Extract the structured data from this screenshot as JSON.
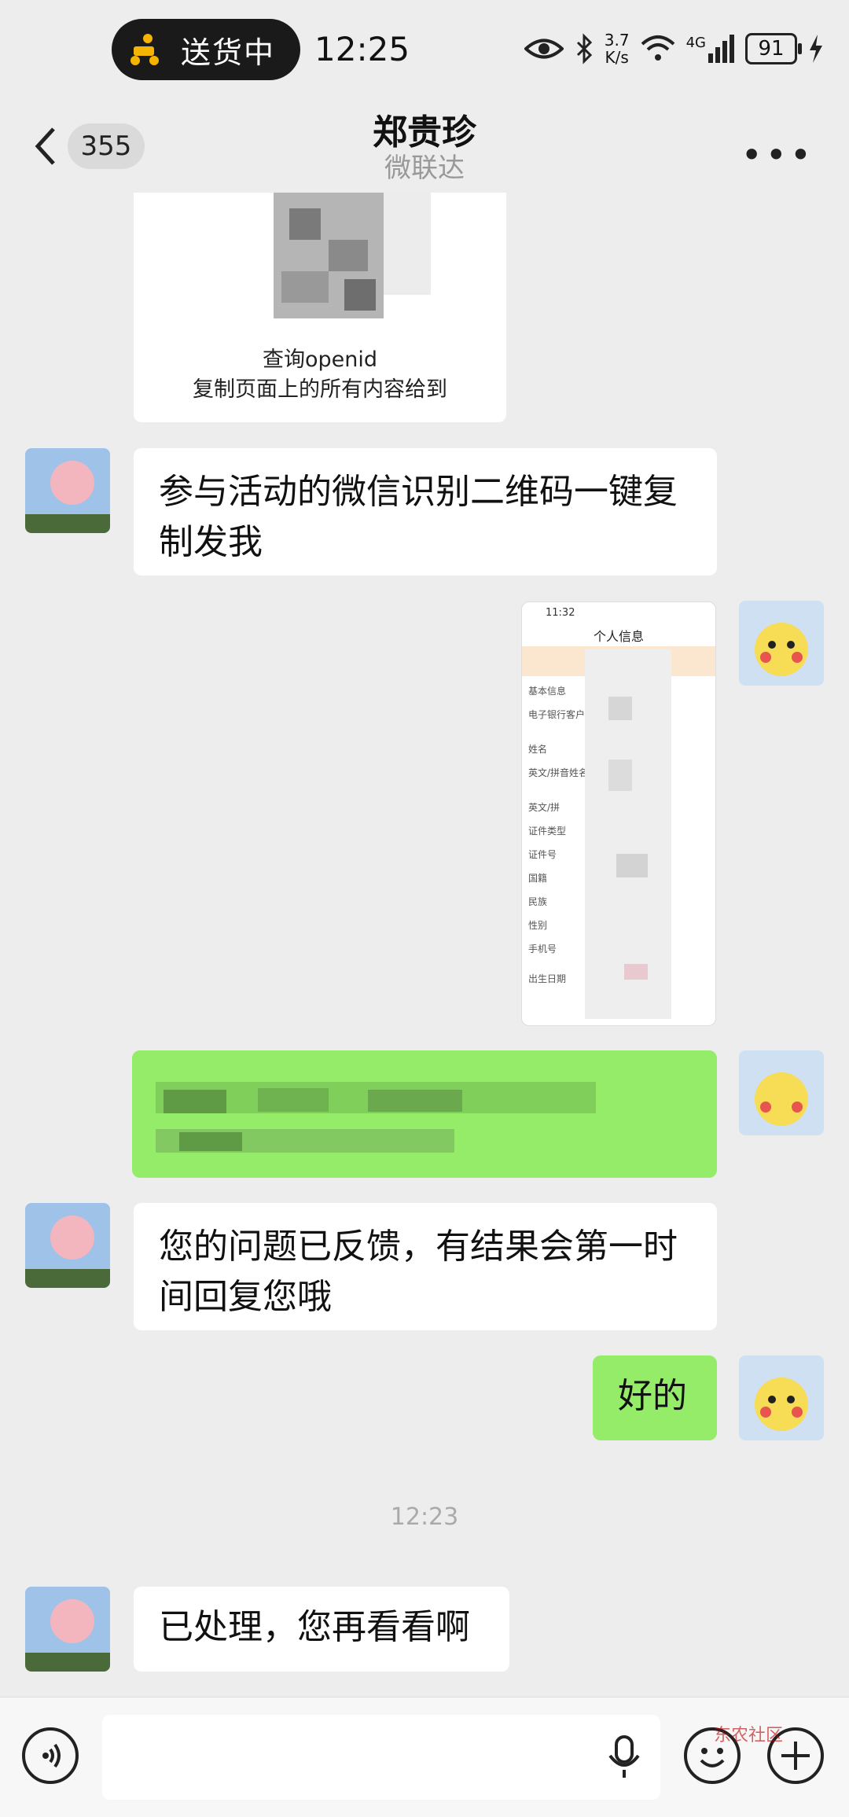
{
  "status_bar": {
    "delivery_label": "送货中",
    "time": "12:25",
    "speed_top": "3.7",
    "speed_bottom": "K/s",
    "network": "4G",
    "battery": "91"
  },
  "header": {
    "unread_count": "355",
    "title": "郑贵珍",
    "subtitle": "微联达"
  },
  "card": {
    "line1": "查询openid",
    "line2": "复制页面上的所有内容给到"
  },
  "messages": {
    "m1": "参与活动的微信识别二维码一键复制发我",
    "m2": "您的问题已反馈，有结果会第一时间回复您哦",
    "m3": "好的",
    "m4": "已处理，您再看看啊"
  },
  "screenshot_thumb": {
    "status_time": "11:32",
    "page_title": "个人信息",
    "rows": [
      "基本信息",
      "电子银行客户序号",
      "姓名",
      "英文/拼音姓名",
      "英文/拼",
      "证件类型",
      "证件号",
      "国籍",
      "民族",
      "性别",
      "手机号",
      "出生日期"
    ]
  },
  "timestamp": "12:23",
  "watermark": "东农社区"
}
